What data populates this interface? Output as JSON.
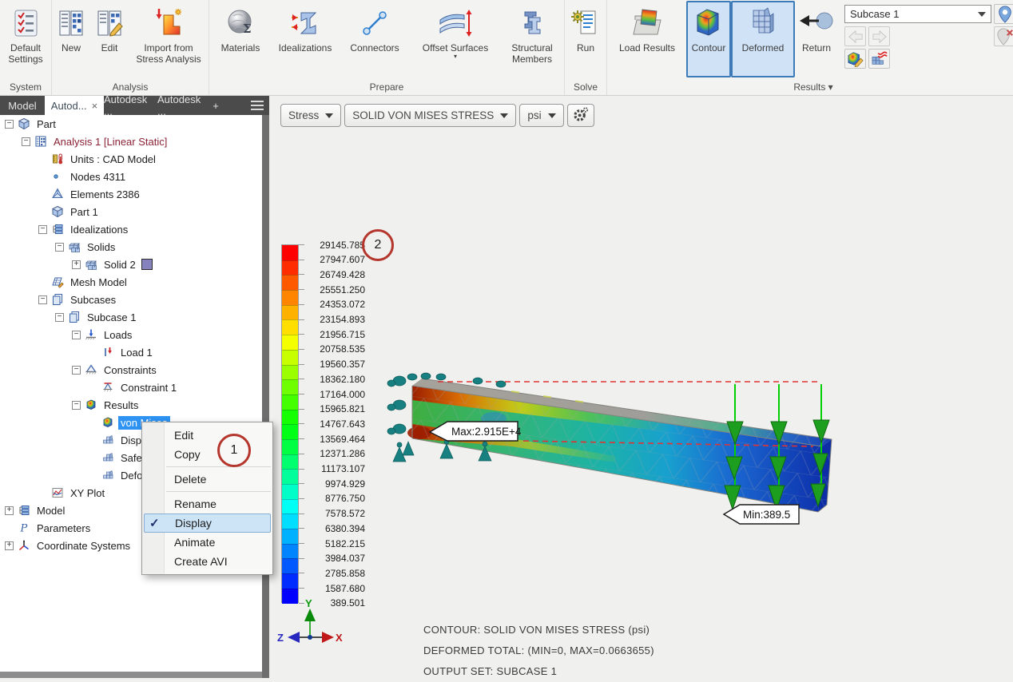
{
  "ribbon": {
    "groups": [
      {
        "label": "System",
        "buttons": [
          {
            "label": "Default Settings",
            "icon": "default-settings-icon"
          }
        ]
      },
      {
        "label": "Analysis",
        "buttons": [
          {
            "label": "New",
            "icon": "new-analysis-icon"
          },
          {
            "label": "Edit",
            "icon": "edit-analysis-icon"
          },
          {
            "label": "Import from Stress Analysis",
            "icon": "import-stress-icon"
          }
        ]
      },
      {
        "label": "Prepare",
        "buttons": [
          {
            "label": "Materials",
            "icon": "materials-icon"
          },
          {
            "label": "Idealizations",
            "icon": "idealizations-icon"
          },
          {
            "label": "Connectors",
            "icon": "connectors-icon"
          },
          {
            "label": "Offset Surfaces",
            "icon": "offset-surfaces-icon",
            "dropdown": true
          },
          {
            "label": "Structural Members",
            "icon": "structural-members-icon"
          }
        ]
      },
      {
        "label": "Solve",
        "buttons": [
          {
            "label": "Run",
            "icon": "run-icon"
          }
        ]
      },
      {
        "label": "Results",
        "dropdown": true,
        "buttons": [
          {
            "label": "Load Results",
            "icon": "load-results-icon"
          },
          {
            "label": "Contour",
            "icon": "contour-icon",
            "active": true
          },
          {
            "label": "Deformed",
            "icon": "deformed-icon",
            "active": true
          },
          {
            "label": "Return",
            "icon": "return-icon"
          }
        ]
      }
    ],
    "subcase_dropdown": {
      "value": "Subcase 1"
    }
  },
  "browser": {
    "tabs": [
      {
        "label": "Model"
      },
      {
        "label": "Autod...",
        "active": true,
        "closable": true
      },
      {
        "label": "Autodesk ..."
      },
      {
        "label": "Autodesk ..."
      },
      {
        "label": "+"
      }
    ],
    "tree": [
      {
        "label": "Part",
        "level": 0,
        "exp": "minus",
        "icon": "part"
      },
      {
        "label": "Analysis 1 [Linear Static]",
        "level": 1,
        "exp": "minus",
        "icon": "analysis",
        "cls": "maroon"
      },
      {
        "label": "Units : CAD Model",
        "level": 2,
        "icon": "units"
      },
      {
        "label": "Nodes 4311",
        "level": 2,
        "icon": "nodes"
      },
      {
        "label": "Elements 2386",
        "level": 2,
        "icon": "elements"
      },
      {
        "label": "Part 1",
        "level": 2,
        "icon": "part"
      },
      {
        "label": "Idealizations",
        "level": 2,
        "exp": "minus",
        "icon": "ideal"
      },
      {
        "label": "Solids",
        "level": 3,
        "exp": "minus",
        "icon": "solids"
      },
      {
        "label": "Solid 2",
        "level": 4,
        "exp": "plus",
        "icon": "solids",
        "swatch": "#8682bd"
      },
      {
        "label": "Mesh Model",
        "level": 2,
        "icon": "mesh"
      },
      {
        "label": "Subcases",
        "level": 2,
        "exp": "minus",
        "icon": "subcases"
      },
      {
        "label": "Subcase 1",
        "level": 3,
        "exp": "minus",
        "icon": "subcases"
      },
      {
        "label": "Loads",
        "level": 4,
        "exp": "minus",
        "icon": "loads"
      },
      {
        "label": "Load 1",
        "level": 5,
        "icon": "load1"
      },
      {
        "label": "Constraints",
        "level": 4,
        "exp": "minus",
        "icon": "constraints"
      },
      {
        "label": "Constraint 1",
        "level": 5,
        "icon": "constraint1"
      },
      {
        "label": "Results",
        "level": 4,
        "exp": "minus",
        "icon": "results"
      },
      {
        "label": "von Mises",
        "level": 5,
        "icon": "results",
        "selected": true
      },
      {
        "label": "Displa",
        "level": 5,
        "icon": "voxel"
      },
      {
        "label": "Safety",
        "level": 5,
        "icon": "voxel"
      },
      {
        "label": "Defor",
        "level": 5,
        "icon": "voxel"
      },
      {
        "label": "XY Plot",
        "level": 2,
        "icon": "xyplot"
      },
      {
        "label": "Model",
        "level": 0,
        "exp": "plus",
        "icon": "ideal"
      },
      {
        "label": "Parameters",
        "level": 0,
        "icon": "param"
      },
      {
        "label": "Coordinate Systems",
        "level": 0,
        "exp": "plus",
        "icon": "coord"
      }
    ]
  },
  "context_menu": {
    "items": [
      {
        "label": "Edit"
      },
      {
        "label": "Copy"
      },
      {
        "sep": true
      },
      {
        "label": "Delete"
      },
      {
        "sep": true
      },
      {
        "label": "Rename"
      },
      {
        "label": "Display",
        "checked": true,
        "highlight": true
      },
      {
        "label": "Animate"
      },
      {
        "label": "Create AVI"
      }
    ]
  },
  "viewport": {
    "result_bar": {
      "category": "Stress",
      "result": "SOLID VON MISES STRESS",
      "unit": "psi"
    },
    "legend_values": [
      "29145.785",
      "27947.607",
      "26749.428",
      "25551.250",
      "24353.072",
      "23154.893",
      "21956.715",
      "20758.535",
      "19560.357",
      "18362.180",
      "17164.000",
      "15965.821",
      "14767.643",
      "13569.464",
      "12371.286",
      "11173.107",
      "9974.929",
      "8776.750",
      "7578.572",
      "6380.394",
      "5182.215",
      "3984.037",
      "2785.858",
      "1587.680",
      "389.501"
    ],
    "callouts": {
      "max": "Max:2.915E+4",
      "min": "Min:389.5"
    },
    "triad": {
      "x": "X",
      "y": "Y",
      "z": "Z"
    },
    "info_lines": [
      "CONTOUR: SOLID VON MISES STRESS (psi)",
      "DEFORMED TOTAL: (MIN=0, MAX=0.0663655)",
      "OUTPUT SET: SUBCASE 1"
    ]
  },
  "annotations": {
    "circles": [
      {
        "label": "1"
      },
      {
        "label": "2"
      }
    ]
  },
  "colors": {
    "selection": "#2e93f2",
    "active_button": "#3d7ab8",
    "maroon": "#8b2135",
    "legend_top": "#ff0000",
    "legend_bottom": "#0000ff",
    "load_arrow": "#1e9e1e",
    "constraint": "#188080",
    "undeformed_dash": "#e03434"
  }
}
